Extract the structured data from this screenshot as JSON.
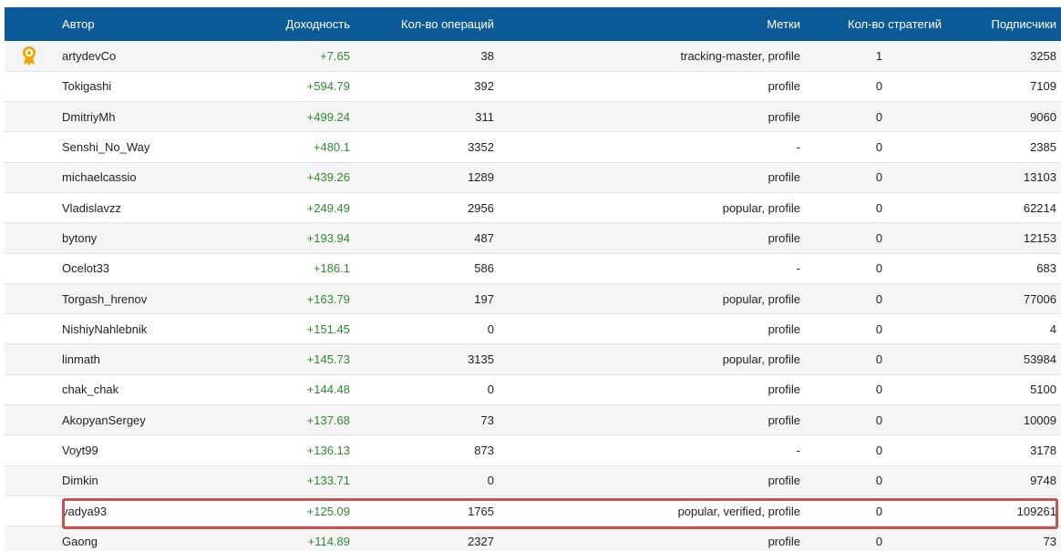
{
  "table": {
    "headers": {
      "author": "Автор",
      "profit": "Доходность",
      "operations": "Кол-во операций",
      "tags": "Метки",
      "strategies": "Кол-во стратегий",
      "subscribers": "Подписчики"
    },
    "rows": [
      {
        "author": "artydevCo",
        "profit": "+7.65",
        "operations": "38",
        "tags": "tracking-master, profile",
        "strategies": "1",
        "subscribers": "3258",
        "badge": "award-ribbon-icon"
      },
      {
        "author": "Tokigashi",
        "profit": "+594.79",
        "operations": "392",
        "tags": "profile",
        "strategies": "0",
        "subscribers": "7109"
      },
      {
        "author": "DmitriyMh",
        "profit": "+499.24",
        "operations": "311",
        "tags": "profile",
        "strategies": "0",
        "subscribers": "9060"
      },
      {
        "author": "Senshi_No_Way",
        "profit": "+480.1",
        "operations": "3352",
        "tags": "-",
        "strategies": "0",
        "subscribers": "2385"
      },
      {
        "author": "michaelcassio",
        "profit": "+439.26",
        "operations": "1289",
        "tags": "profile",
        "strategies": "0",
        "subscribers": "13103"
      },
      {
        "author": "Vladislavzz",
        "profit": "+249.49",
        "operations": "2956",
        "tags": "popular, profile",
        "strategies": "0",
        "subscribers": "62214"
      },
      {
        "author": "bytony",
        "profit": "+193.94",
        "operations": "487",
        "tags": "profile",
        "strategies": "0",
        "subscribers": "12153"
      },
      {
        "author": "Ocelot33",
        "profit": "+186.1",
        "operations": "586",
        "tags": "-",
        "strategies": "0",
        "subscribers": "683"
      },
      {
        "author": "Torgash_hrenov",
        "profit": "+163.79",
        "operations": "197",
        "tags": "popular, profile",
        "strategies": "0",
        "subscribers": "77006"
      },
      {
        "author": "NishiyNahlebnik",
        "profit": "+151.45",
        "operations": "0",
        "tags": "profile",
        "strategies": "0",
        "subscribers": "4"
      },
      {
        "author": "linmath",
        "profit": "+145.73",
        "operations": "3135",
        "tags": "popular, profile",
        "strategies": "0",
        "subscribers": "53984"
      },
      {
        "author": "chak_chak",
        "profit": "+144.48",
        "operations": "0",
        "tags": "profile",
        "strategies": "0",
        "subscribers": "5100"
      },
      {
        "author": "AkopyanSergey",
        "profit": "+137.68",
        "operations": "73",
        "tags": "profile",
        "strategies": "0",
        "subscribers": "10009"
      },
      {
        "author": "Voyt99",
        "profit": "+136.13",
        "operations": "873",
        "tags": "-",
        "strategies": "0",
        "subscribers": "3178"
      },
      {
        "author": "Dimkin",
        "profit": "+133.71",
        "operations": "0",
        "tags": "profile",
        "strategies": "0",
        "subscribers": "9748"
      },
      {
        "author": "vadya93",
        "profit": "+125.09",
        "operations": "1765",
        "tags": "popular, verified, profile",
        "strategies": "0",
        "subscribers": "109261",
        "highlighted": true
      },
      {
        "author": "Gaong",
        "profit": "+114.89",
        "operations": "2327",
        "tags": "profile",
        "strategies": "0",
        "subscribers": "73"
      }
    ]
  },
  "colors": {
    "header_bg": "#0d5a99",
    "profit": "#2e8b2e",
    "highlight": "#c9524c",
    "badge": "#f0a500"
  }
}
